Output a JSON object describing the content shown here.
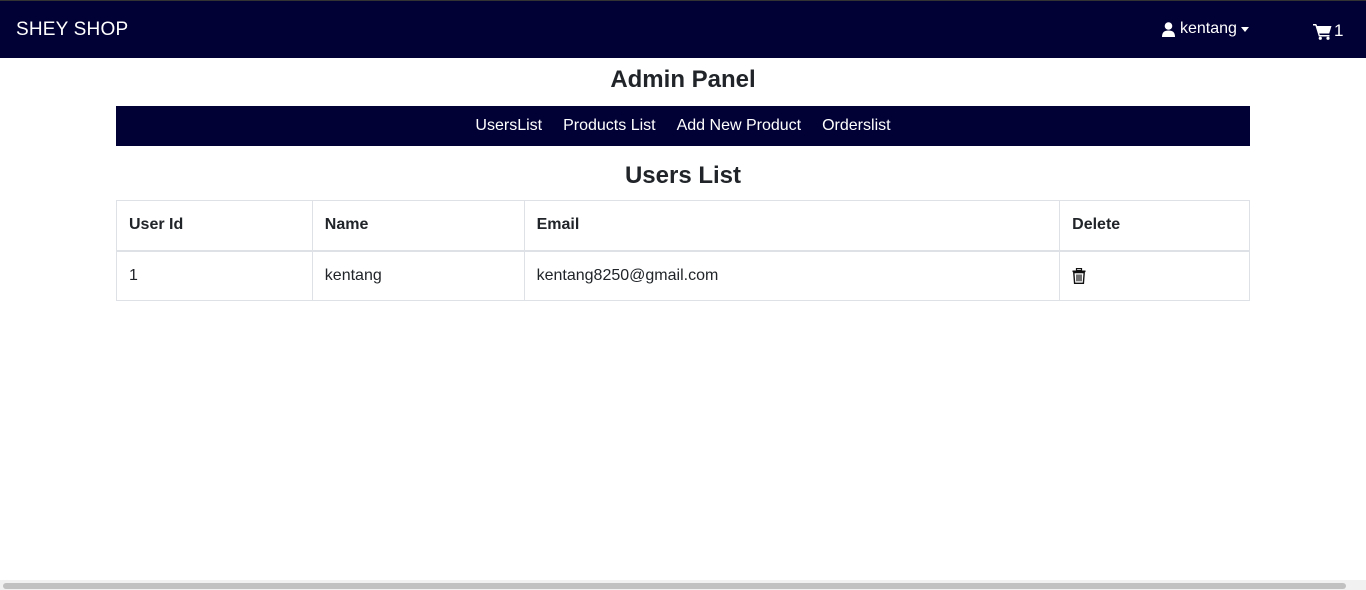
{
  "header": {
    "brand": "SHEY SHOP",
    "user_name": "kentang",
    "cart_count": "1",
    "user_icon": "user-icon",
    "cart_icon": "shopping-cart-icon",
    "background_color": "#020135"
  },
  "admin": {
    "title": "Admin Panel",
    "nav": [
      "UsersList",
      "Products List",
      "Add New Product",
      "Orderslist"
    ]
  },
  "users_list": {
    "title": "Users List",
    "columns": [
      "User Id",
      "Name",
      "Email",
      "Delete"
    ],
    "rows": [
      {
        "id": "1",
        "name": "kentang",
        "email": "kentang8250@gmail.com",
        "delete_icon": "trash-icon"
      }
    ]
  }
}
